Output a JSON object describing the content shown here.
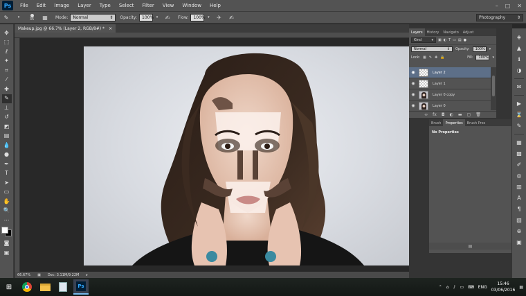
{
  "app": {
    "logo": "Ps"
  },
  "menu": [
    "File",
    "Edit",
    "Image",
    "Layer",
    "Type",
    "Select",
    "Filter",
    "View",
    "Window",
    "Help"
  ],
  "window_controls": [
    "–",
    "□",
    "✕"
  ],
  "options": {
    "brush_size": "35",
    "mode_label": "Mode:",
    "mode_value": "Normal",
    "opacity_label": "Opacity:",
    "opacity_value": "100%",
    "flow_label": "Flow:",
    "flow_value": "100%",
    "workspace": "Photography"
  },
  "document": {
    "tab_title": "Makeup.jpg @ 66.7% (Layer 2, RGB/8#) *",
    "close": "×"
  },
  "status": {
    "zoom": "66.67%",
    "doc": "Doc: 3.11M/9.22M"
  },
  "layers_panel": {
    "tabs": [
      "Layers",
      "History",
      "Navigato",
      "Adjust"
    ],
    "filter_kind": "Kind",
    "blend_mode": "Normal",
    "opacity_label": "Opacity:",
    "opacity_value": "100%",
    "lock_label": "Lock:",
    "fill_label": "Fill:",
    "fill_value": "100%",
    "layers": [
      {
        "name": "Layer 2",
        "active": true,
        "type": "transparent"
      },
      {
        "name": "Layer 1",
        "active": false,
        "type": "transparent"
      },
      {
        "name": "Layer 0 copy",
        "active": false,
        "type": "photo"
      },
      {
        "name": "Layer 0",
        "active": false,
        "type": "photo"
      }
    ],
    "footer_icons": [
      "link-icon",
      "fx-icon",
      "mask-icon",
      "adjustment-icon",
      "folder-icon",
      "new-layer-icon",
      "trash-icon"
    ]
  },
  "properties_panel": {
    "tabs": [
      "Brush",
      "Properties",
      "Brush Pres"
    ],
    "message": "No Properties"
  },
  "taskbar": {
    "lang": "ENG",
    "time": "15:46",
    "date": "03/06/2016"
  },
  "colors": {
    "accent": "#5d6f88",
    "panel": "#535353",
    "canvas_bg": "#282828"
  }
}
